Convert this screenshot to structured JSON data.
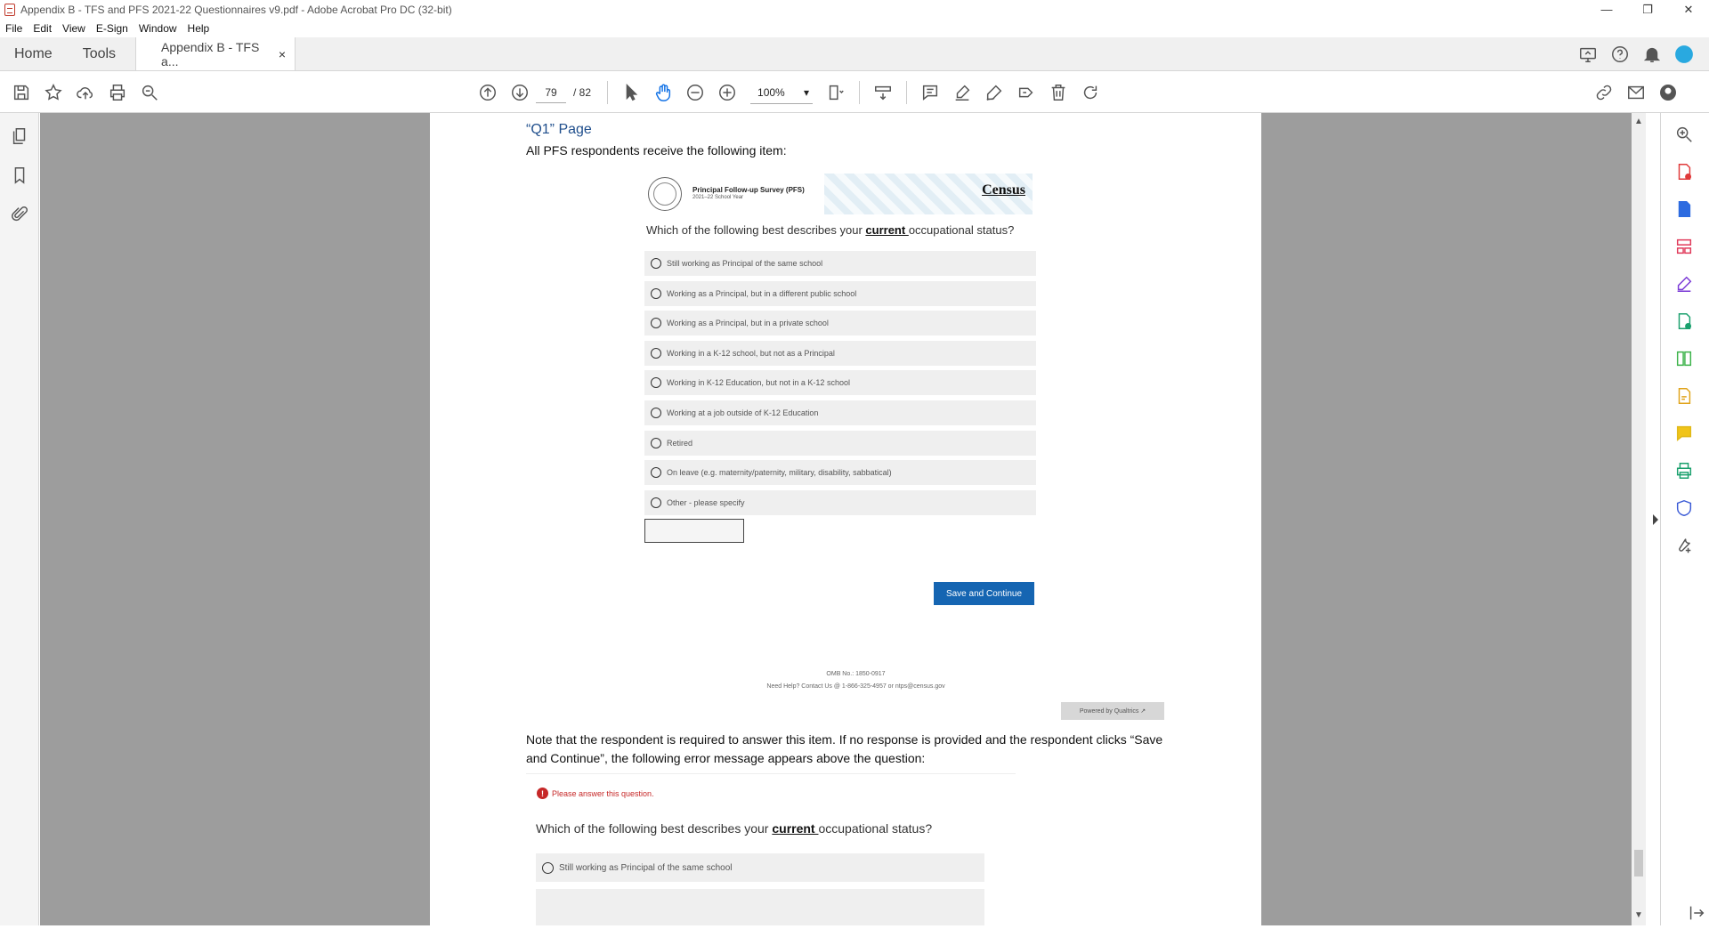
{
  "window": {
    "title": "Appendix B - TFS and PFS 2021-22 Questionnaires v9.pdf - Adobe Acrobat Pro DC (32-bit)",
    "minimize": "—",
    "restore": "❐",
    "close": "✕"
  },
  "menu": [
    "File",
    "Edit",
    "View",
    "E-Sign",
    "Window",
    "Help"
  ],
  "tabs": {
    "home": "Home",
    "tools": "Tools",
    "document": "Appendix B - TFS a...",
    "close": "×"
  },
  "toolbar": {
    "current_page": "79",
    "total_pages": "/ 82",
    "zoom": "100%",
    "zoom_arrow": "▾"
  },
  "pdf": {
    "page_title": "“Q1” Page",
    "intro": "All PFS respondents receive the following item:",
    "survey_name": "Principal Follow-up Survey (PFS)",
    "survey_year": "2021–22 School Year",
    "census_logo": "Census",
    "question_prefix": "Which of the following best describes your ",
    "question_emphasis": "current ",
    "question_suffix": "occupational status?",
    "options": [
      "Still working as Principal of the same school",
      "Working as a Principal, but in a different public school",
      "Working as a Principal, but in a private school",
      "Working in a K-12 school, but not as a Principal",
      "Working in K-12 Education, but not in a K-12 school",
      "Working at a job outside of K-12 Education",
      "Retired",
      "On leave (e.g. maternity/paternity, military, disability, sabbatical)",
      "Other - please specify"
    ],
    "save_button": "Save and Continue",
    "omb": "OMB No.: 1850-0917",
    "help": "Need Help? Contact Us @ 1-866-325-4957 or ntps@census.gov",
    "qualtrics": "Powered by Qualtrics ↗",
    "note": "Note that the respondent is required to answer this item. If no response is provided and the respondent clicks “Save and Continue”, the following error message appears above the question:",
    "error": "Please answer this question.",
    "option2_first": "Still working as Principal of the same school"
  },
  "icons": {
    "save": "save-icon",
    "bookmark": "star-icon",
    "upload": "upload-icon",
    "print": "print-icon",
    "search": "zoom-search-icon"
  }
}
